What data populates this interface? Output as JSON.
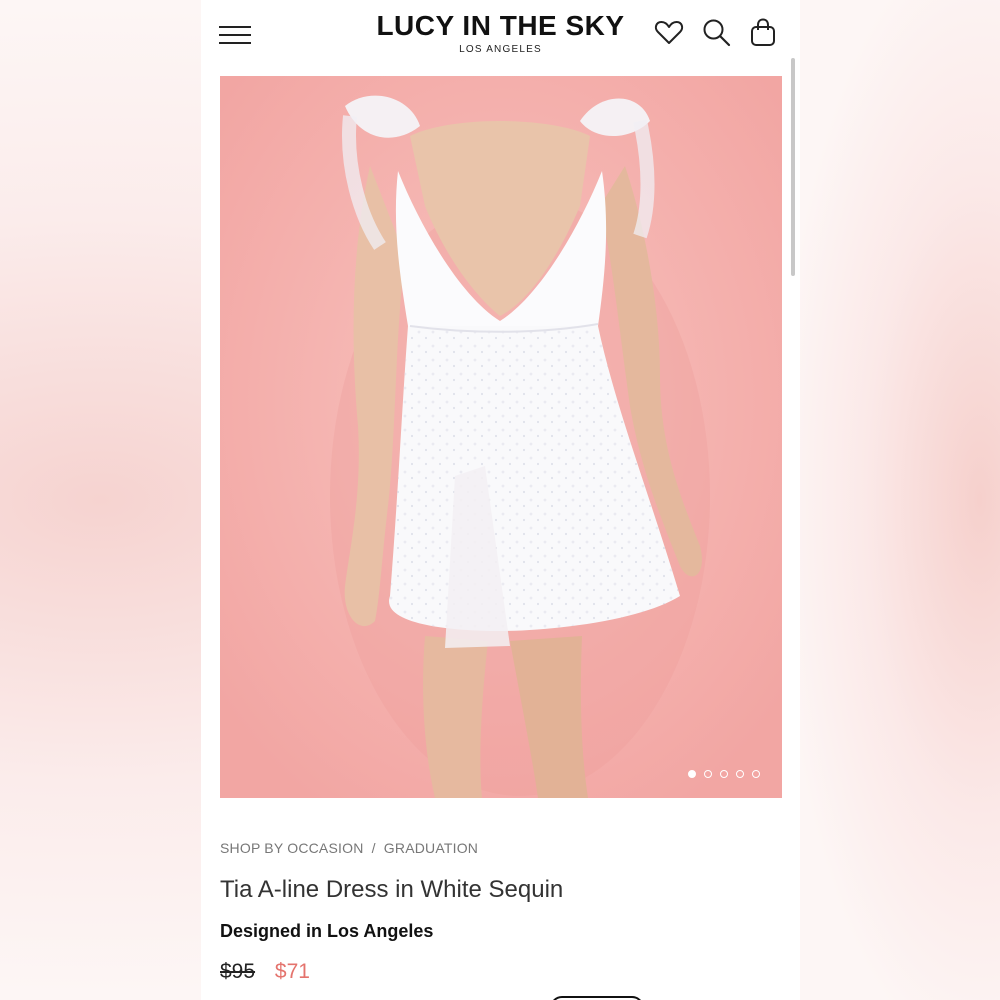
{
  "header": {
    "logo_main": "LUCY IN THE SKY",
    "logo_sub": "LOS ANGELES",
    "icons": [
      "menu-icon",
      "heart-icon",
      "search-icon",
      "shopping-bag-icon"
    ]
  },
  "gallery": {
    "slide_count": 5,
    "active_slide": 1,
    "background_color": "#f4aaa7"
  },
  "breadcrumb": {
    "parent": "SHOP BY OCCASION",
    "separator": "/",
    "current": "GRADUATION"
  },
  "product": {
    "title": "Tia A-line Dress in White Sequin",
    "designed": "Designed in Los Angeles",
    "old_price": "$95",
    "new_price": "$71",
    "sale_color": "#e4736d"
  }
}
